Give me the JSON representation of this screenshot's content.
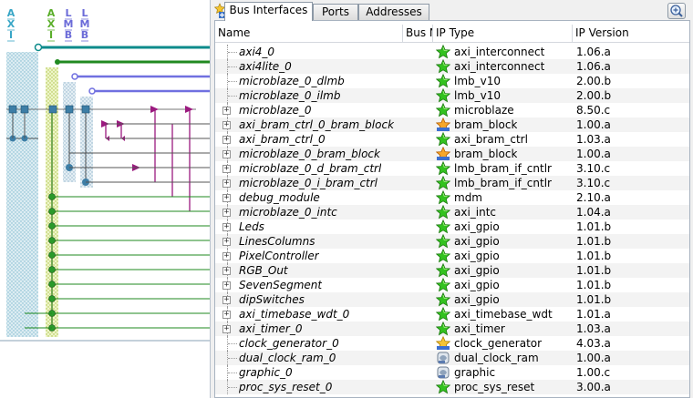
{
  "bus_labels": [
    "AXI",
    "AXI",
    "LMB",
    "LMB"
  ],
  "tabs": [
    {
      "label": "Bus Interfaces",
      "active": true
    },
    {
      "label": "Ports",
      "active": false
    },
    {
      "label": "Addresses",
      "active": false
    }
  ],
  "columns": {
    "name": "Name",
    "bus": "Bus N",
    "ip_type": "IP Type",
    "ip_version": "IP Version"
  },
  "rows": [
    {
      "name": "axi4_0",
      "ip_type": "axi_interconnect",
      "version": "1.06.a",
      "icon": "green-star-icon",
      "expandable": false
    },
    {
      "name": "axi4lite_0",
      "ip_type": "axi_interconnect",
      "version": "1.06.a",
      "icon": "green-star-icon",
      "expandable": false
    },
    {
      "name": "microblaze_0_dlmb",
      "ip_type": "lmb_v10",
      "version": "2.00.b",
      "icon": "green-star-icon",
      "expandable": false
    },
    {
      "name": "microblaze_0_ilmb",
      "ip_type": "lmb_v10",
      "version": "2.00.b",
      "icon": "green-star-icon",
      "expandable": false
    },
    {
      "name": "microblaze_0",
      "ip_type": "microblaze",
      "version": "8.50.c",
      "icon": "green-star-icon",
      "expandable": true
    },
    {
      "name": "axi_bram_ctrl_0_bram_block",
      "ip_type": "bram_block",
      "version": "1.00.a",
      "icon": "bram-block-icon",
      "expandable": true
    },
    {
      "name": "axi_bram_ctrl_0",
      "ip_type": "axi_bram_ctrl",
      "version": "1.03.a",
      "icon": "green-star-icon",
      "expandable": true
    },
    {
      "name": "microblaze_0_bram_block",
      "ip_type": "bram_block",
      "version": "1.00.a",
      "icon": "bram-block-icon",
      "expandable": true
    },
    {
      "name": "microblaze_0_d_bram_ctrl",
      "ip_type": "lmb_bram_if_cntlr",
      "version": "3.10.c",
      "icon": "green-star-icon",
      "expandable": true
    },
    {
      "name": "microblaze_0_i_bram_ctrl",
      "ip_type": "lmb_bram_if_cntlr",
      "version": "3.10.c",
      "icon": "green-star-icon",
      "expandable": true
    },
    {
      "name": "debug_module",
      "ip_type": "mdm",
      "version": "2.10.a",
      "icon": "green-star-icon",
      "expandable": true
    },
    {
      "name": "microblaze_0_intc",
      "ip_type": "axi_intc",
      "version": "1.04.a",
      "icon": "green-star-icon",
      "expandable": true
    },
    {
      "name": "Leds",
      "ip_type": "axi_gpio",
      "version": "1.01.b",
      "icon": "green-star-icon",
      "expandable": true
    },
    {
      "name": "LinesColumns",
      "ip_type": "axi_gpio",
      "version": "1.01.b",
      "icon": "green-star-icon",
      "expandable": true
    },
    {
      "name": "PixelController",
      "ip_type": "axi_gpio",
      "version": "1.01.b",
      "icon": "green-star-icon",
      "expandable": true
    },
    {
      "name": "RGB_Out",
      "ip_type": "axi_gpio",
      "version": "1.01.b",
      "icon": "green-star-icon",
      "expandable": true
    },
    {
      "name": "SevenSegment",
      "ip_type": "axi_gpio",
      "version": "1.01.b",
      "icon": "green-star-icon",
      "expandable": true
    },
    {
      "name": "dipSwitches",
      "ip_type": "axi_gpio",
      "version": "1.01.b",
      "icon": "green-star-icon",
      "expandable": true
    },
    {
      "name": "axi_timebase_wdt_0",
      "ip_type": "axi_timebase_wdt",
      "version": "1.01.a",
      "icon": "green-star-icon",
      "expandable": true
    },
    {
      "name": "axi_timer_0",
      "ip_type": "axi_timer",
      "version": "1.03.a",
      "icon": "green-star-icon",
      "expandable": true
    },
    {
      "name": "clock_generator_0",
      "ip_type": "clock_generator",
      "version": "4.03.a",
      "icon": "clock-generator-icon",
      "expandable": false
    },
    {
      "name": "dual_clock_ram_0",
      "ip_type": "dual_clock_ram",
      "version": "1.00.a",
      "icon": "custom-ip-icon",
      "expandable": false
    },
    {
      "name": "graphic_0",
      "ip_type": "graphic",
      "version": "1.00.c",
      "icon": "custom-ip-icon",
      "expandable": false
    },
    {
      "name": "proc_sys_reset_0",
      "ip_type": "proc_sys_reset",
      "version": "3.00.a",
      "icon": "green-star-icon",
      "expandable": false
    }
  ],
  "colors": {
    "axi_bus": "#0c8b8b",
    "axi_lite_bus": "#208a20",
    "lmb_bus": "#7070e0",
    "bram_bus": "#9b1a7f",
    "label_teal": "#39a6c6",
    "label_green": "#5aae2a",
    "label_lmb": "#6b6bd8"
  }
}
